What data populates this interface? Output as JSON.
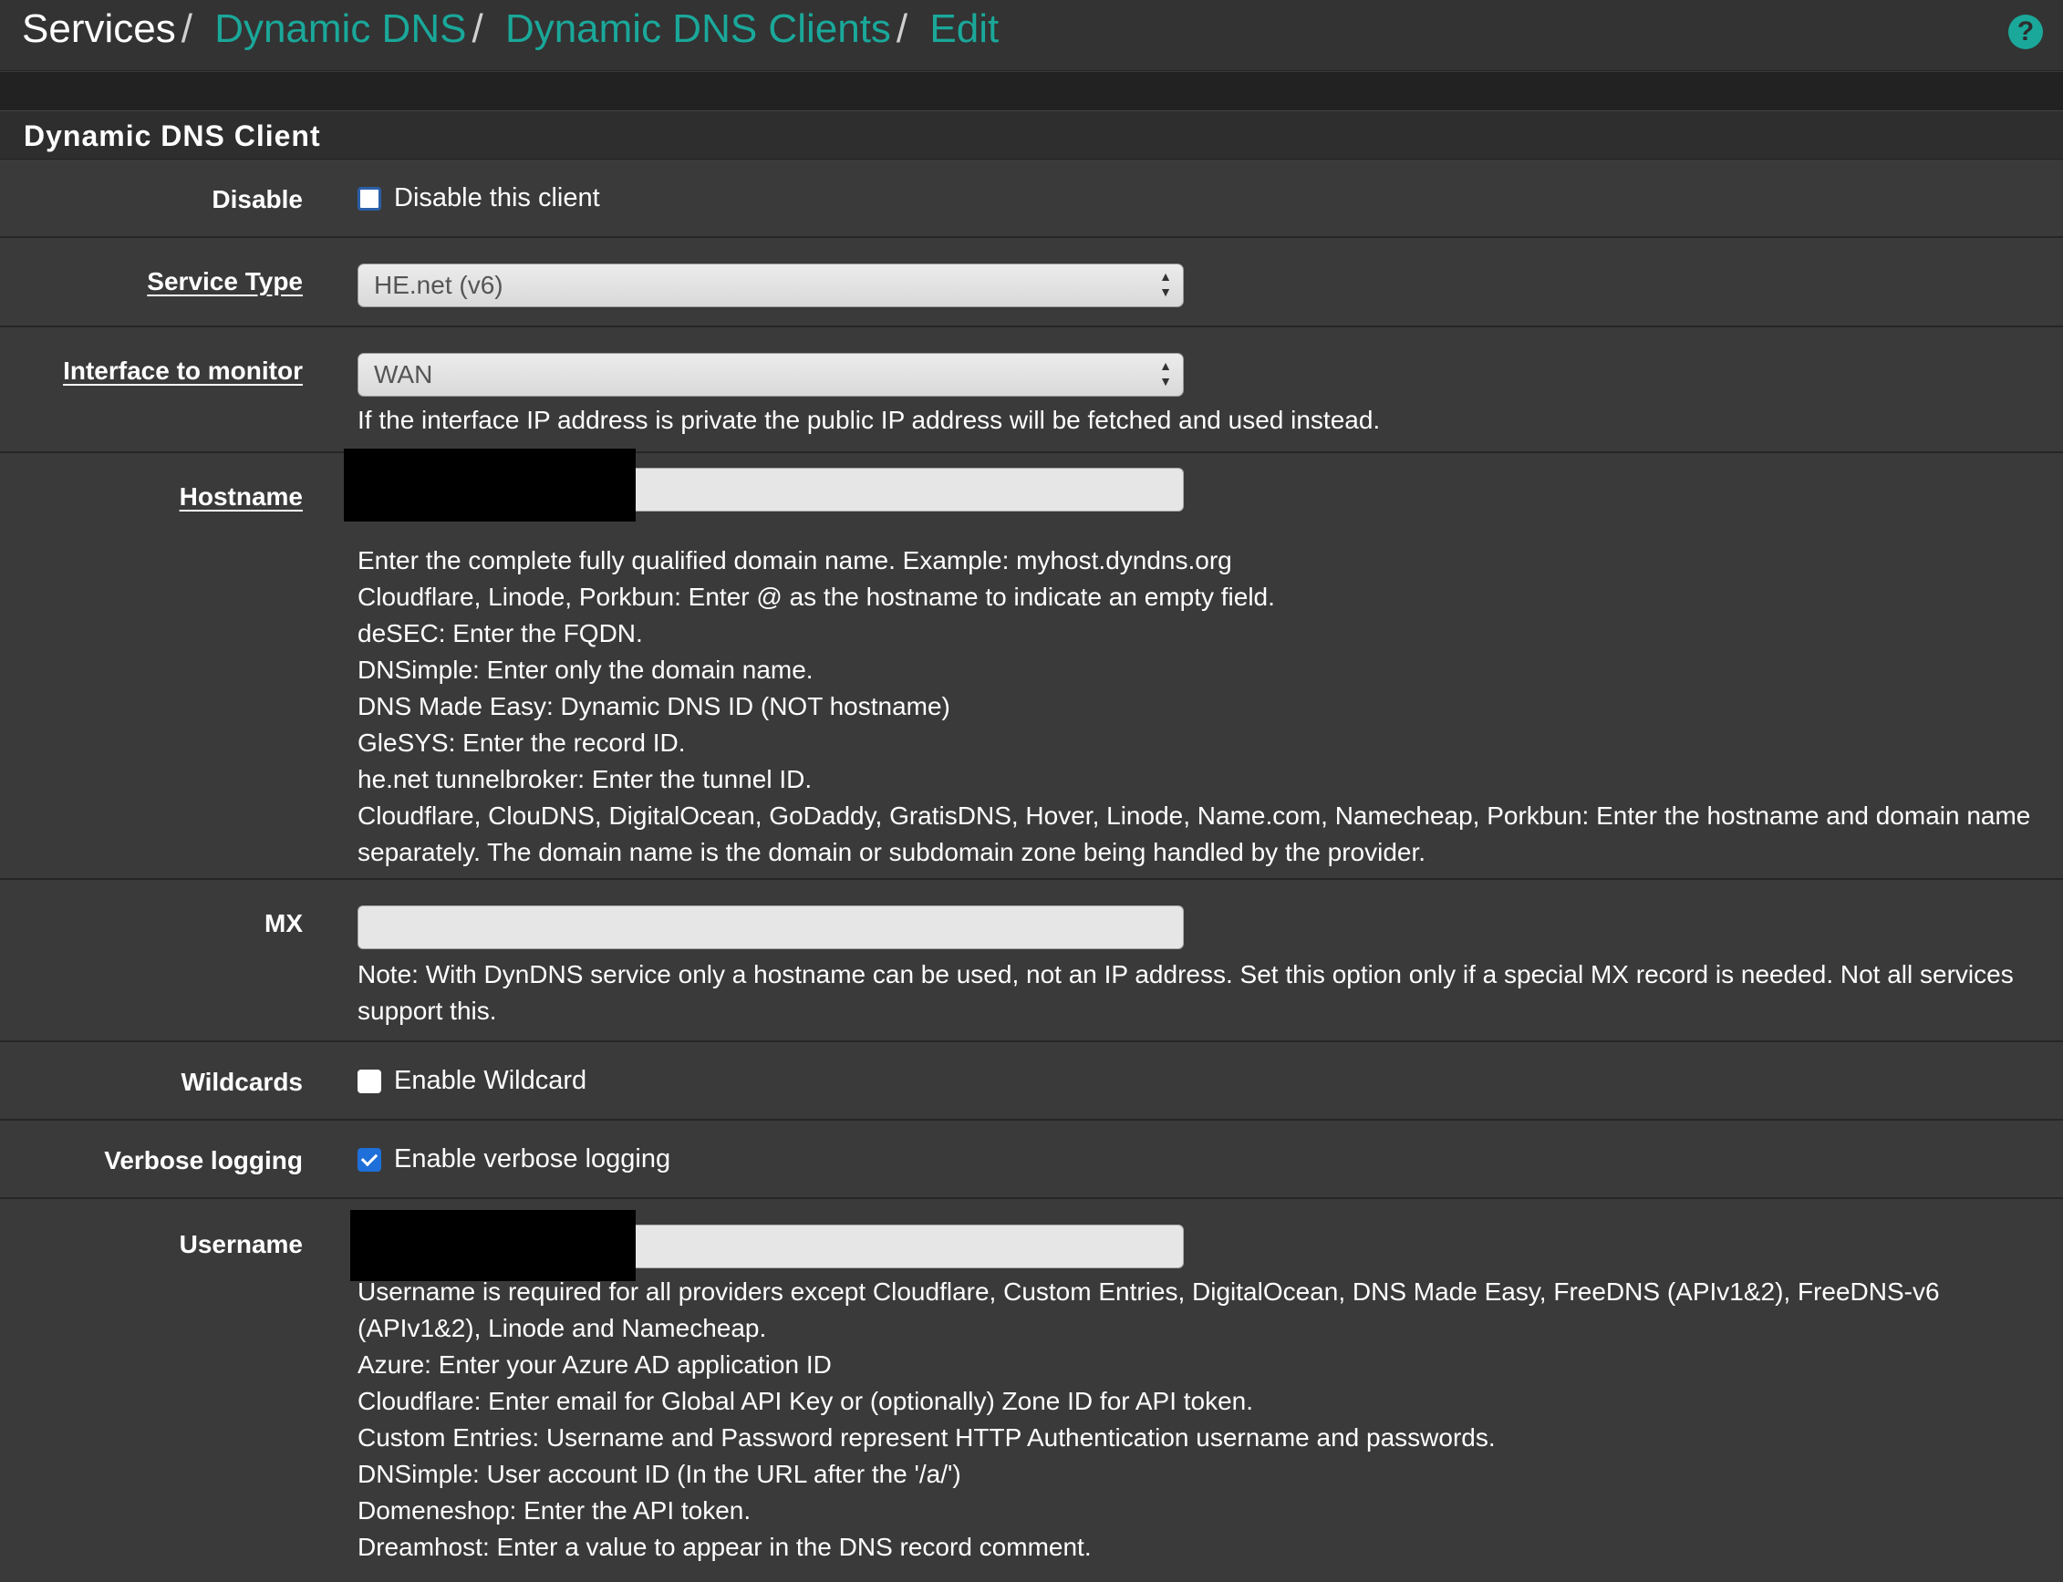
{
  "breadcrumb": {
    "root": "Services",
    "items": [
      "Dynamic DNS",
      "Dynamic DNS Clients",
      "Edit"
    ],
    "separator": "/"
  },
  "help_icon": "question-circle-icon",
  "panel": {
    "title": "Dynamic DNS Client"
  },
  "fields": {
    "disable": {
      "label": "Disable",
      "checkbox_label": "Disable this client",
      "checked": false
    },
    "service_type": {
      "label": "Service Type",
      "value": "HE.net (v6)"
    },
    "interface": {
      "label": "Interface to monitor",
      "value": "WAN",
      "help": "If the interface IP address is private the public IP address will be fetched and used instead."
    },
    "hostname": {
      "label": "Hostname",
      "value": "",
      "help": [
        "Enter the complete fully qualified domain name. Example: myhost.dyndns.org",
        "Cloudflare, Linode, Porkbun: Enter @ as the hostname to indicate an empty field.",
        "deSEC: Enter the FQDN.",
        "DNSimple: Enter only the domain name.",
        "DNS Made Easy: Dynamic DNS ID (NOT hostname)",
        "GleSYS: Enter the record ID.",
        "he.net tunnelbroker: Enter the tunnel ID.",
        "Cloudflare, ClouDNS, DigitalOcean, GoDaddy, GratisDNS, Hover, Linode, Name.com, Namecheap, Porkbun: Enter the hostname and domain name separately. The domain name is the domain or subdomain zone being handled by the provider."
      ]
    },
    "mx": {
      "label": "MX",
      "value": "",
      "help": "Note: With DynDNS service only a hostname can be used, not an IP address. Set this option only if a special MX record is needed. Not all services support this."
    },
    "wildcards": {
      "label": "Wildcards",
      "checkbox_label": "Enable Wildcard",
      "checked": false
    },
    "verbose": {
      "label": "Verbose logging",
      "checkbox_label": "Enable verbose logging",
      "checked": true
    },
    "username": {
      "label": "Username",
      "value": "",
      "help": [
        "Username is required for all providers except Cloudflare, Custom Entries, DigitalOcean, DNS Made Easy, FreeDNS (APIv1&2), FreeDNS-v6 (APIv1&2), Linode and Namecheap.",
        "Azure: Enter your Azure AD application ID",
        "Cloudflare: Enter email for Global API Key or (optionally) Zone ID for API token.",
        "Custom Entries: Username and Password represent HTTP Authentication username and passwords.",
        "DNSimple: User account ID (In the URL after the '/a/')",
        "Domeneshop: Enter the API token.",
        "Dreamhost: Enter a value to appear in the DNS record comment."
      ]
    }
  },
  "colors": {
    "accent": "#1aa89a",
    "background": "#3a3a3a",
    "checkbox_checked": "#1e6fd9"
  }
}
